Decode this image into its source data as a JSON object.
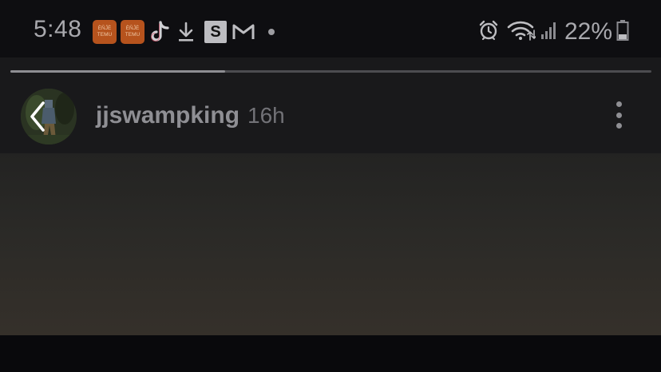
{
  "status_bar": {
    "time": "5:48",
    "temu_badge_text": [
      "ÈÑĴÈ",
      "TEMU"
    ],
    "icons": [
      "temu-app-icon",
      "temu-app-icon",
      "tiktok-icon",
      "download-icon",
      "s-app-icon",
      "gmail-icon",
      "notification-dot"
    ],
    "s_badge_label": "S",
    "right_icons": [
      "alarm-icon",
      "wifi-icon",
      "signal-icon",
      "battery-icon"
    ],
    "battery_percent": "22%"
  },
  "story": {
    "progress_fraction": 0.335,
    "username": "jjswampking",
    "timestamp": "16h",
    "back_icon": "chevron-left-icon",
    "more_icon": "more-vertical-icon"
  },
  "colors": {
    "status_bar_bg": "#0e0e11",
    "header_bg": "#19191b",
    "text_muted": "#8f8f94",
    "temu_orange": "#b6531d"
  }
}
